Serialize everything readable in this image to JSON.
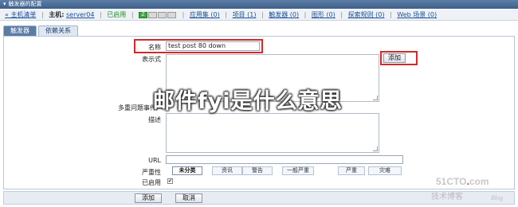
{
  "window": {
    "title": "触发器的配置"
  },
  "hostbar": {
    "back_label": "« 主机清单",
    "host_label": "主机:",
    "host_name": "server04",
    "enabled_label": "已启用",
    "status_boxes": [
      "Z",
      "",
      "",
      ""
    ],
    "links": [
      "应用集 (0)",
      "项目 (1)",
      "触发器 (0)",
      "图形 (0)",
      "探索规则 (0)",
      "Web 场景 (0)"
    ]
  },
  "tabs": [
    {
      "label": "触发器",
      "active": true
    },
    {
      "label": "依赖关系",
      "active": false
    }
  ],
  "form": {
    "name_label": "名称",
    "name_value": "test post 80 down",
    "expression_label": "表示式",
    "add_expression_label": "添加",
    "multi_event_label": "多重问题事件产",
    "description_label": "描述",
    "url_label": "URL",
    "severity_label": "严重性",
    "severities": [
      {
        "label": "未分类",
        "active": true
      },
      {
        "label": "资讯",
        "active": false
      },
      {
        "label": "警告",
        "active": false
      },
      {
        "label": "一般严重",
        "active": false
      },
      {
        "label": "严重",
        "active": false
      },
      {
        "label": "灾难",
        "active": false
      }
    ],
    "enabled_label": "已启用",
    "enabled_checked": true
  },
  "footer": {
    "add_label": "添加",
    "cancel_label": "取消"
  },
  "overlay": {
    "text": "邮件fyi是什么意思"
  },
  "watermark": {
    "main_a": "51CTO",
    "main_dot": ".",
    "main_b": "com",
    "sub": "技术博客",
    "blog": "Blog"
  },
  "colors": {
    "highlight": "#d12a2a",
    "link": "#1c4f96",
    "enabled": "#1c8a1c"
  }
}
